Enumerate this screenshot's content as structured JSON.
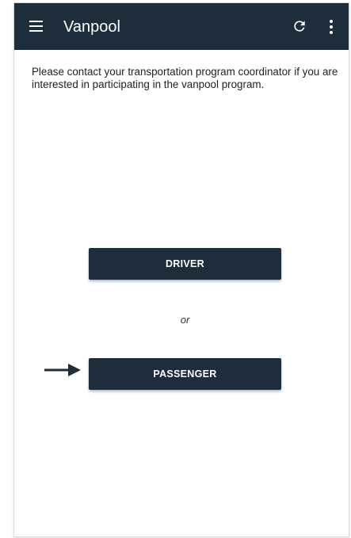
{
  "colors": {
    "app_bar": "#1e2d3b",
    "button": "#1e2d3b",
    "arrow": "#1e2d3b"
  },
  "app_bar": {
    "title": "Vanpool",
    "menu_icon": "hamburger-menu-icon",
    "refresh_icon": "refresh-icon",
    "more_icon": "more-vertical-icon"
  },
  "content": {
    "message": "Please contact your transportation program coordinator if you are interested in participating in the vanpool program.",
    "driver_button_label": "DRIVER",
    "separator_text": "or",
    "passenger_button_label": "PASSENGER",
    "pointer_icon": "arrow-right-icon"
  }
}
